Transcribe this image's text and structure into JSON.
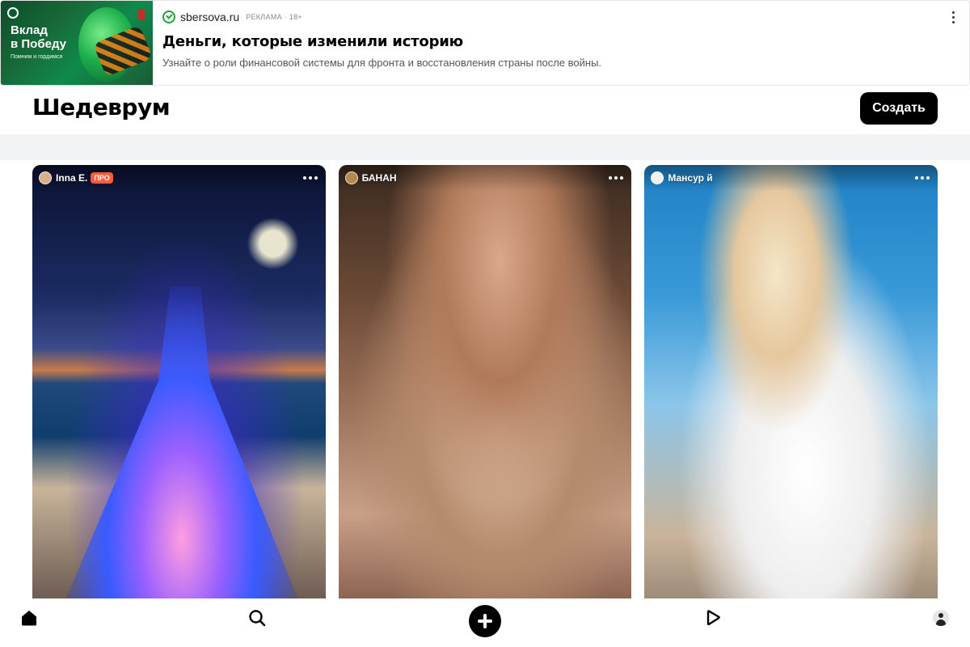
{
  "ad": {
    "image_title": "Вклад\nв Победу",
    "image_subtitle": "Помним и гордимся",
    "domain": "sbersova.ru",
    "label": "РЕКЛАМА · 18+",
    "title": "Деньги, которые изменили историю",
    "description": "Узнайте о роли финансовой системы для фронта и восстановления страны после войны.",
    "icons": {
      "source": "sber-check-icon",
      "menu": "more-vertical-icon"
    },
    "accent_color": "#21a038"
  },
  "header": {
    "logo": "Шедеврум",
    "create_label": "Создать"
  },
  "feed": {
    "cards": [
      {
        "author": "Inna E.",
        "badge": "ПРО",
        "image": "girl-in-glowing-gown-on-beach-under-moon"
      },
      {
        "author": "БАНАН",
        "badge": "",
        "image": "woman-in-silk-nightgown"
      },
      {
        "author": "Мансур й",
        "badge": "",
        "image": "blonde-woman-in-white-hoodie"
      }
    ]
  },
  "nav": {
    "items": [
      {
        "name": "home",
        "icon": "home-icon"
      },
      {
        "name": "search",
        "icon": "search-icon"
      },
      {
        "name": "create",
        "icon": "plus-icon"
      },
      {
        "name": "videos",
        "icon": "play-icon"
      },
      {
        "name": "profile",
        "icon": "user-icon"
      }
    ]
  }
}
